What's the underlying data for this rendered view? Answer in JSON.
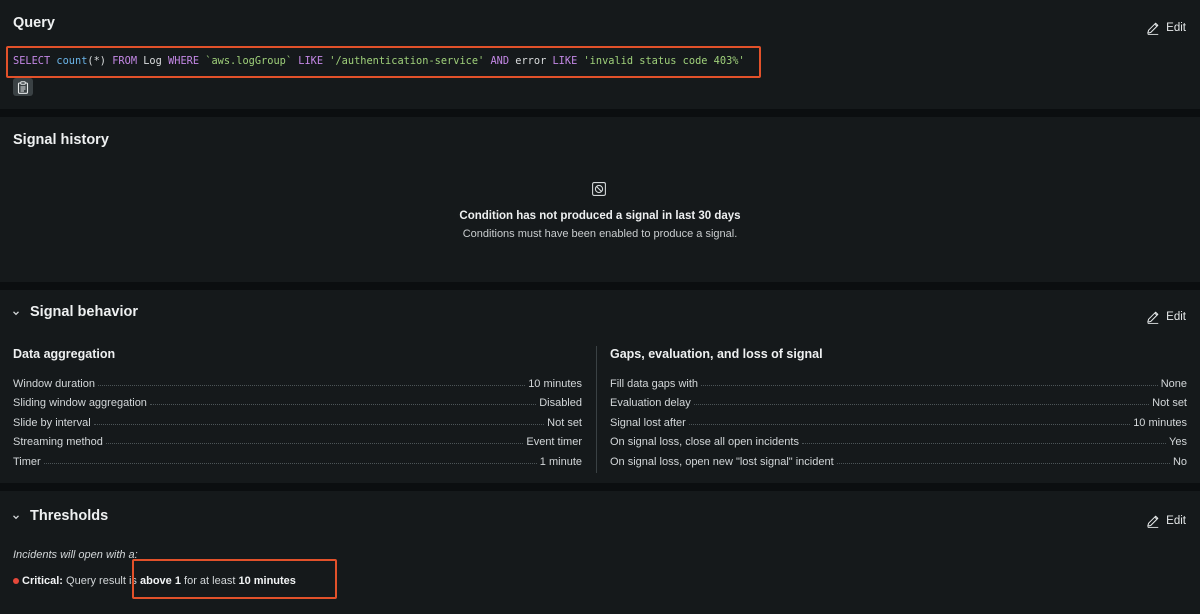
{
  "query": {
    "title": "Query",
    "edit_label": "Edit",
    "nrql": {
      "select": "SELECT",
      "count": "count",
      "args": "(*)",
      "from": "FROM",
      "table": "Log",
      "where": "WHERE",
      "attr1": "`aws.logGroup`",
      "like1": "LIKE",
      "value1": "'/authentication-service'",
      "and": "AND",
      "attr2": "error",
      "like2": "LIKE",
      "value2": "'invalid status code 403%'"
    }
  },
  "signal_history": {
    "title": "Signal history",
    "empty_title": "Condition has not produced a signal in last 30 days",
    "empty_subtitle": "Conditions must have been enabled to produce a signal."
  },
  "signal_behavior": {
    "title": "Signal behavior",
    "edit_label": "Edit",
    "data_aggregation": {
      "title": "Data aggregation",
      "rows": [
        {
          "label": "Window duration",
          "value": "10 minutes"
        },
        {
          "label": "Sliding window aggregation",
          "value": "Disabled"
        },
        {
          "label": "Slide by interval",
          "value": "Not set"
        },
        {
          "label": "Streaming method",
          "value": "Event timer"
        },
        {
          "label": "Timer",
          "value": "1 minute"
        }
      ]
    },
    "gaps": {
      "title": "Gaps, evaluation, and loss of signal",
      "rows": [
        {
          "label": "Fill data gaps with",
          "value": "None"
        },
        {
          "label": "Evaluation delay",
          "value": "Not set"
        },
        {
          "label": "Signal lost after",
          "value": "10 minutes"
        },
        {
          "label": "On signal loss, close all open incidents",
          "value": "Yes"
        },
        {
          "label": "On signal loss, open new \"lost signal\" incident",
          "value": "No"
        }
      ]
    }
  },
  "thresholds": {
    "title": "Thresholds",
    "edit_label": "Edit",
    "note": "Incidents will open with a:",
    "critical_label": "Critical:",
    "critical_text1": " Query result is ",
    "critical_op": "above 1",
    "critical_text2": " for at least ",
    "critical_duration": "10 minutes"
  },
  "colors": {
    "highlight": "#e2512a",
    "critical": "#e5483a",
    "keyword": "#c488e6",
    "function": "#6ab4e8",
    "string": "#9fd07a"
  },
  "icons": [
    "pencil-icon",
    "clipboard-icon",
    "no-signal-icon",
    "chevron-down-icon"
  ]
}
